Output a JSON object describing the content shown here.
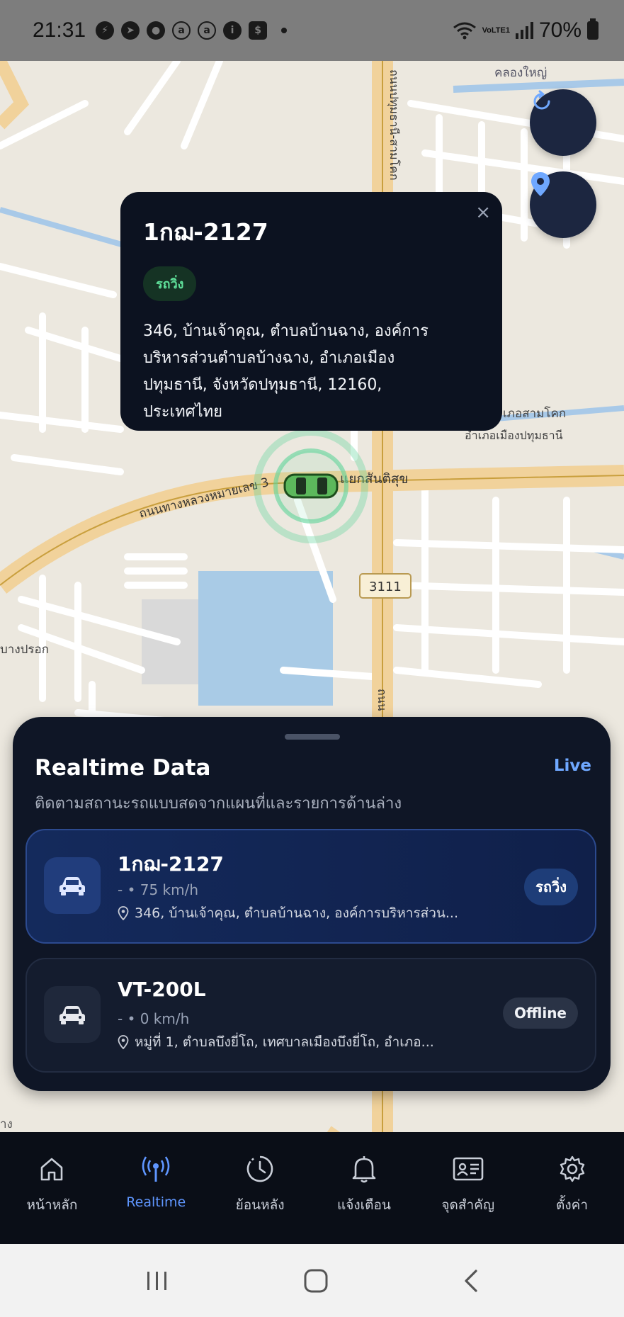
{
  "status_bar": {
    "time": "21:31",
    "network": "VoLTE1",
    "battery": "70%"
  },
  "map": {
    "labels": {
      "road_west": "ถนนทางหลวงหมายเลข 3",
      "junction": "แยกสันติสุข",
      "route_shield": "3111",
      "khlong": "คลองใหญ่",
      "district_1": "เภอสามโคก",
      "district_2": "อำเภอเมืองปทุมธานี",
      "road_north": "ถนนปทุมธานี-สามโคก",
      "place_west": "บางปรอก",
      "road_south": "ถนน",
      "corner": "าง"
    }
  },
  "popup": {
    "title": "1กฌ-2127",
    "badge": "รถวิ่ง",
    "address_lines": [
      "346, บ้านเจ้าคุณ, ตำบลบ้านฉาง, องค์การ",
      "บริหารส่วนตำบลบ้างฉาง, อำเภอเมือง",
      "ปทุมธานี, จังหวัดปทุมธานี, 12160,",
      "ประเทศไทย"
    ],
    "close": "×"
  },
  "sheet": {
    "title": "Realtime Data",
    "live": "Live",
    "subtitle": "ติดตามสถานะรถแบบสดจากแผนที่และรายการด้านล่าง",
    "vehicles": [
      {
        "name": "1กฌ-2127",
        "speed": "- • 75 km/h",
        "address": "346, บ้านเจ้าคุณ, ตำบลบ้านฉาง, องค์การบริหารส่วน...",
        "status": "รถวิ่ง"
      },
      {
        "name": "VT-200L",
        "speed": "- • 0 km/h",
        "address": "หมู่ที่ 1, ตำบลบึงยี่โถ, เทศบาลเมืองบึงยี่โถ, อำเภอ...",
        "status": "Offline"
      }
    ]
  },
  "nav": {
    "items": [
      {
        "label": "หน้าหลัก",
        "icon": "home-icon"
      },
      {
        "label": "Realtime",
        "icon": "broadcast-icon"
      },
      {
        "label": "ย้อนหลัง",
        "icon": "history-icon"
      },
      {
        "label": "แจ้งเตือน",
        "icon": "bell-icon"
      },
      {
        "label": "จุดสำคัญ",
        "icon": "id-card-icon"
      },
      {
        "label": "ตั้งค่า",
        "icon": "gear-icon"
      }
    ]
  },
  "colors": {
    "accent": "#5f96ff",
    "running_badge": "#5fe09a",
    "panel": "#0f1626",
    "nav_bg": "#0a0e17"
  }
}
